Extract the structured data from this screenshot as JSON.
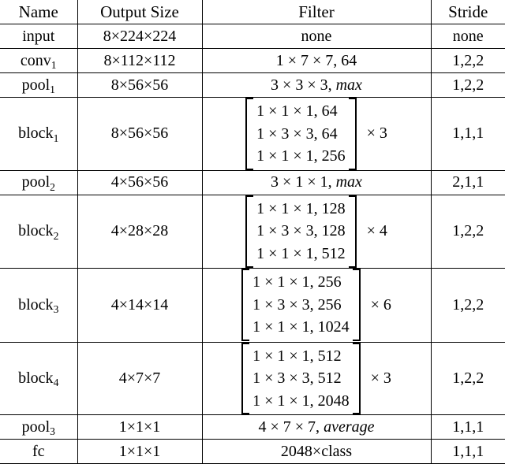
{
  "table": {
    "caption": "",
    "columns": [
      "Name",
      "Output Size",
      "Filter",
      "Stride"
    ],
    "rows": [
      {
        "name": "input",
        "name_sub": "",
        "output": "8×224×224",
        "filter_type": "text",
        "filter": "none",
        "stride": "none"
      },
      {
        "name": "conv",
        "name_sub": "1",
        "output": "8×112×112",
        "filter_type": "text",
        "filter": "1 × 7 × 7, 64",
        "stride": "1,2,2"
      },
      {
        "name": "pool",
        "name_sub": "1",
        "output": "8×56×56",
        "filter_type": "text_italic_tail",
        "filter": "3 × 3 × 3, ",
        "filter_italic": "max",
        "stride": "1,2,2"
      },
      {
        "name": "block",
        "name_sub": "1",
        "output": "8×56×56",
        "filter_type": "matrix",
        "matrix": [
          "1 × 1 × 1, 64",
          "1 × 3 × 3, 64",
          "1 × 1 × 1, 256"
        ],
        "multiplier": "× 3",
        "stride": "1,1,1"
      },
      {
        "name": "pool",
        "name_sub": "2",
        "output": "4×56×56",
        "filter_type": "text_italic_tail",
        "filter": "3 × 1 × 1, ",
        "filter_italic": "max",
        "stride": "2,1,1"
      },
      {
        "name": "block",
        "name_sub": "2",
        "output": "4×28×28",
        "filter_type": "matrix",
        "matrix": [
          "1 × 1 × 1, 128",
          "1 × 3 × 3, 128",
          "1 × 1 × 1, 512"
        ],
        "multiplier": "× 4",
        "stride": "1,2,2"
      },
      {
        "name": "block",
        "name_sub": "3",
        "output": "4×14×14",
        "filter_type": "matrix",
        "matrix": [
          "1 × 1 × 1, 256",
          "1 × 3 × 3, 256",
          "1 × 1 × 1, 1024"
        ],
        "multiplier": "× 6",
        "stride": "1,2,2"
      },
      {
        "name": "block",
        "name_sub": "4",
        "output": "4×7×7",
        "filter_type": "matrix",
        "matrix": [
          "1 × 1 × 1, 512",
          "1 × 3 × 3, 512",
          "1 × 1 × 1, 2048"
        ],
        "multiplier": "× 3",
        "stride": "1,2,2"
      },
      {
        "name": "pool",
        "name_sub": "3",
        "output": "1×1×1",
        "filter_type": "text_italic_tail",
        "filter": "4 × 7 × 7, ",
        "filter_italic": "average",
        "stride": "1,1,1"
      },
      {
        "name": "fc",
        "name_sub": "",
        "output": "1×1×1",
        "filter_type": "text",
        "filter": "2048×class",
        "stride": "1,1,1"
      }
    ]
  },
  "style": {
    "rule_color": "#000000",
    "background": "#ffffff",
    "text_color": "#000000"
  }
}
